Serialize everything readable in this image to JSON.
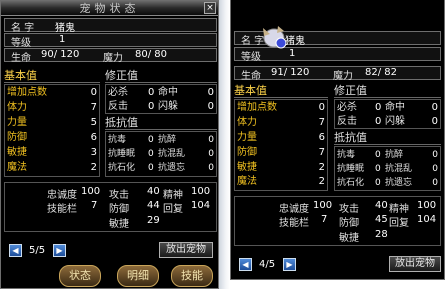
{
  "left": {
    "title": "宠物状态",
    "close_icon": "×",
    "name_label": "名  字",
    "name_value": "猪鬼",
    "level_label": "等级",
    "level_value": "1",
    "hp_label": "生命",
    "hp_value": "90/ 120",
    "mp_label": "魔力",
    "mp_value": "80/ 80",
    "basic_header": "基本值",
    "fix_header": "修正值",
    "resist_header": "抵抗值",
    "basic": [
      {
        "label": "增加点数",
        "value": "0"
      },
      {
        "label": "体力",
        "value": "7"
      },
      {
        "label": "力量",
        "value": "5"
      },
      {
        "label": "防御",
        "value": "6"
      },
      {
        "label": "敏捷",
        "value": "3"
      },
      {
        "label": "魔法",
        "value": "2"
      }
    ],
    "fix": [
      {
        "l1": "必杀",
        "v1": "0",
        "l2": "命中",
        "v2": "0"
      },
      {
        "l1": "反击",
        "v1": "0",
        "l2": "闪躲",
        "v2": "0"
      }
    ],
    "resist": [
      {
        "l1": "抗毒",
        "v1": "0",
        "l2": "抗醉",
        "v2": "0"
      },
      {
        "l1": "抗睡眠",
        "v1": "0",
        "l2": "抗混乱",
        "v2": "0"
      },
      {
        "l1": "抗石化",
        "v1": "0",
        "l2": "抗遗忘",
        "v2": "0"
      }
    ],
    "loyalty_label": "忠诚度",
    "loyalty_value": "100",
    "skill_label": "技能栏",
    "skill_value": "7",
    "attack_label": "攻击",
    "attack_value": "40",
    "agility_label": "精神",
    "agility_value": "100",
    "defense_label": "防御",
    "defense_value": "44",
    "recover_label": "回复",
    "recover_value": "104",
    "speed_label": "敏捷",
    "speed_value": "29",
    "page": "5/5",
    "release_button": "放出宠物",
    "tabs": [
      "状态",
      "明细",
      "技能"
    ]
  },
  "right": {
    "name_label": "名  字",
    "name_value": "猪鬼",
    "level_label": "等级",
    "level_value": "1",
    "hp_label": "生命",
    "hp_value": "91/ 120",
    "mp_label": "魔力",
    "mp_value": "82/ 82",
    "basic_header": "基本值",
    "fix_header": "修正值",
    "resist_header": "抵抗值",
    "basic": [
      {
        "label": "增加点数",
        "value": "0"
      },
      {
        "label": "体力",
        "value": "7"
      },
      {
        "label": "力量",
        "value": "6"
      },
      {
        "label": "防御",
        "value": "7"
      },
      {
        "label": "敏捷",
        "value": "2"
      },
      {
        "label": "魔法",
        "value": "2"
      }
    ],
    "fix": [
      {
        "l1": "必杀",
        "v1": "0",
        "l2": "命中",
        "v2": "0"
      },
      {
        "l1": "反击",
        "v1": "0",
        "l2": "闪躲",
        "v2": "0"
      }
    ],
    "resist": [
      {
        "l1": "抗毒",
        "v1": "0",
        "l2": "抗醉",
        "v2": "0"
      },
      {
        "l1": "抗睡眠",
        "v1": "0",
        "l2": "抗混乱",
        "v2": "0"
      },
      {
        "l1": "抗石化",
        "v1": "0",
        "l2": "抗遗忘",
        "v2": "0"
      }
    ],
    "loyalty_label": "忠诚度",
    "loyalty_value": "100",
    "skill_label": "技能栏",
    "skill_value": "7",
    "attack_label": "攻击",
    "attack_value": "40",
    "agility_label": "精神",
    "agility_value": "100",
    "defense_label": "防御",
    "defense_value": "45",
    "recover_label": "回复",
    "recover_value": "104",
    "speed_label": "敏捷",
    "speed_value": "28",
    "page": "4/5",
    "release_button": "放出宠物"
  },
  "icons": {
    "prev": "◀",
    "next": "▶"
  }
}
